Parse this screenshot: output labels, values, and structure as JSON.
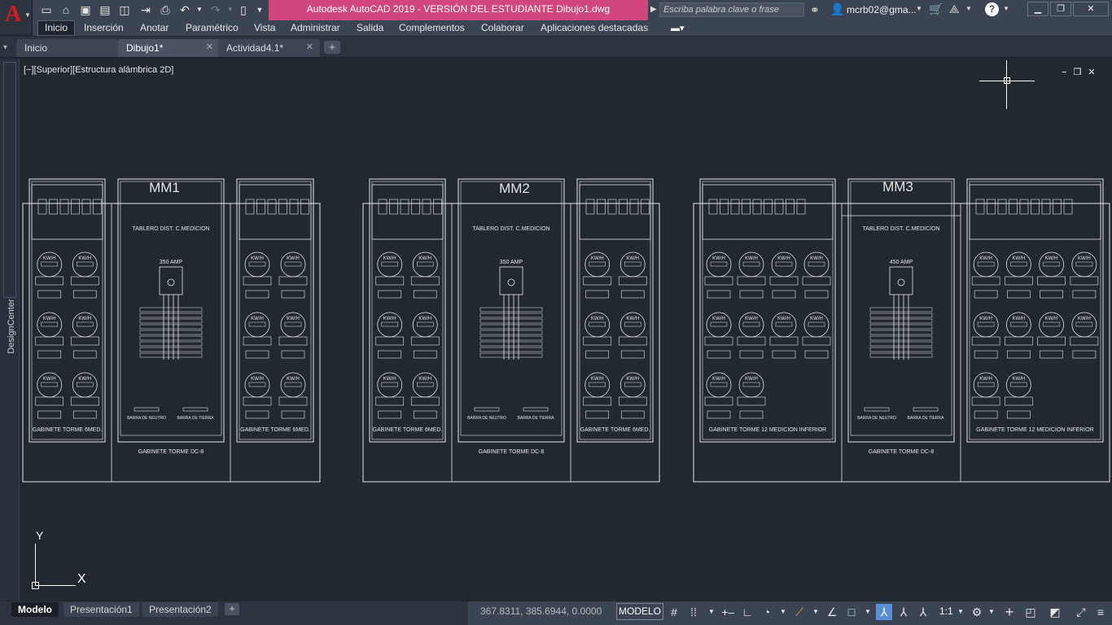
{
  "app": {
    "logo": "A",
    "title": "Autodesk AutoCAD 2019 - VERSIÓN DEL ESTUDIANTE   Dibujo1.dwg",
    "search_placeholder": "Escriba palabra clave o frase",
    "user": "mcrb02@gma...",
    "accent_color": "#d2467e",
    "logo_color": "#e0161d"
  },
  "quick_access": {
    "icons": [
      "new-icon",
      "open-icon",
      "save-icon",
      "save-as-icon",
      "open-web-icon",
      "save-web-icon",
      "plot-icon",
      "undo-icon",
      "redo-icon",
      "workspace-icon",
      "customize-icon"
    ]
  },
  "menu": {
    "items": [
      "Inicio",
      "Inserción",
      "Anotar",
      "Paramétrico",
      "Vista",
      "Administrar",
      "Salida",
      "Complementos",
      "Colaborar",
      "Aplicaciones destacadas"
    ]
  },
  "file_tabs": [
    {
      "label": "Inicio",
      "closable": false
    },
    {
      "label": "Dibujo1*",
      "closable": true
    },
    {
      "label": "Actividad4.1*",
      "closable": true
    }
  ],
  "sidebar": {
    "label": "DesignCenter"
  },
  "viewport": {
    "label": "[−][Superior][Estructura alámbrica 2D]",
    "controls": [
      "−",
      "❐",
      "✕"
    ],
    "ucs_y": "Y",
    "ucs_x": "X"
  },
  "drawing": {
    "groups": [
      {
        "title": "MM1",
        "amp": "350 AMP",
        "left_label": "GABINETE TORME 6MED.",
        "center_label": "GABINETE TORME DC-8",
        "right_label": "GABINETE TORME 6MED."
      },
      {
        "title": "MM2",
        "amp": "350 AMP",
        "left_label": "GABINETE TORME 6MED.",
        "center_label": "GABINETE TORME DC-8",
        "right_label": "GABINETE TORME 6MED."
      },
      {
        "title": "MM3",
        "amp": "450 AMP",
        "left_label": "GABINETE TORME 12 MEDICION INFERIOR",
        "center_label": "GABINETE TORME DC-8",
        "right_label": "GABINETE TORME 12 MEDICION INFERIOR"
      }
    ],
    "center_header": "TABLERO DIST. C.MEDICION",
    "meter_label": "KW/H",
    "barra_neutro": "BARRA DE NEUTRO",
    "barra_tierra": "BARRA DE TIERRA"
  },
  "layout_tabs": [
    "Modelo",
    "Presentación1",
    "Presentación2"
  ],
  "status": {
    "coords": "367.8311, 385.6944, 0.0000",
    "mode": "MODELO",
    "scale": "1:1"
  }
}
